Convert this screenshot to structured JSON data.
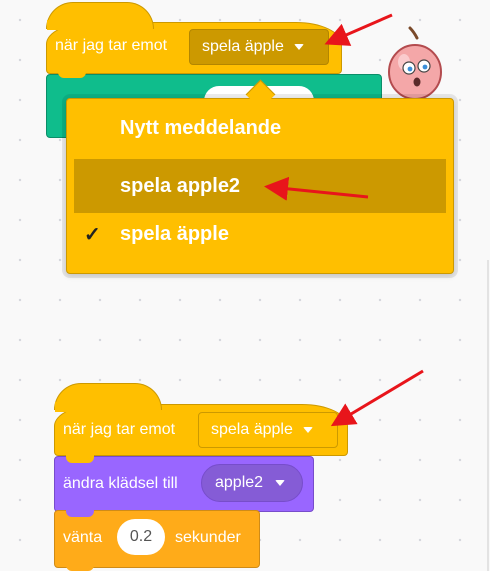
{
  "top_script": {
    "hat_label": "när jag tar emot",
    "selected_message": "spela äpple"
  },
  "dropdown": {
    "items": [
      {
        "label": "Nytt meddelande",
        "checked": false,
        "highlighted": false
      },
      {
        "label": "spela apple2",
        "checked": false,
        "highlighted": true
      },
      {
        "label": "spela äpple",
        "checked": true,
        "highlighted": false
      }
    ],
    "check_glyph": "✓"
  },
  "bottom_script": {
    "hat_label": "när jag tar emot",
    "selected_message": "spela äpple",
    "looks_label": "ändra klädsel till",
    "costume": "apple2",
    "wait_label": "vänta",
    "wait_value": "0.2",
    "wait_unit": "sekunder"
  },
  "sprite": {
    "icon": "apple-sprite-icon"
  },
  "annotations": {
    "arrow_color": "#e8151b"
  },
  "colors": {
    "events": "#ffbf00",
    "looks": "#9966ff",
    "control": "#ffab19",
    "sound": "#0fbd8c"
  }
}
